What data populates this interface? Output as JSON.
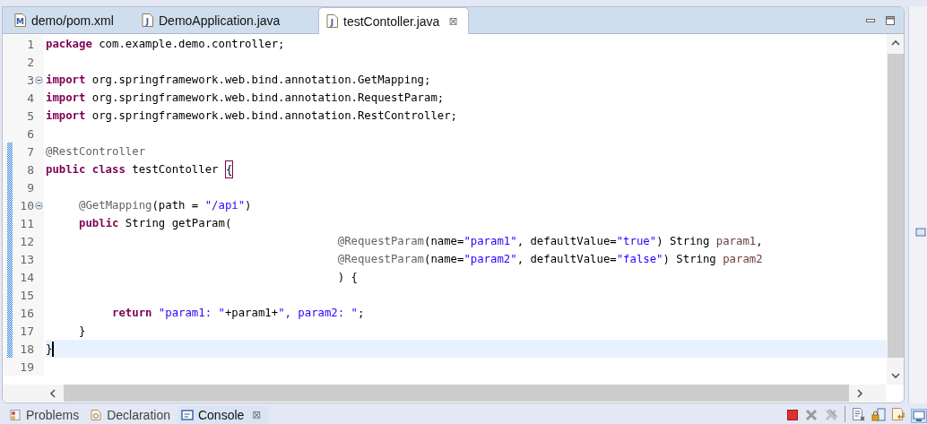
{
  "editor_tabs": [
    {
      "label": "demo/pom.xml",
      "icon": "M",
      "selected": false
    },
    {
      "label": "DemoApplication.java",
      "icon": "J",
      "selected": false
    },
    {
      "label": "testContoller.java",
      "icon": "J",
      "selected": true,
      "close": "⊠"
    }
  ],
  "lines": [
    {
      "number": "1",
      "kind": "top",
      "fold": false,
      "changed": false,
      "current": false,
      "segments": [
        {
          "kind": "keyword",
          "text": "package"
        },
        {
          "kind": "plain",
          "text": "com.example.demo.controller;"
        }
      ]
    },
    {
      "number": "2",
      "kind": "top",
      "fold": false,
      "changed": false,
      "current": false
    },
    {
      "number": "3",
      "kind": "top",
      "fold": true,
      "changed": false,
      "current": false,
      "segments": [
        {
          "kind": "keyword",
          "text": "import"
        },
        {
          "kind": "plain",
          "text": "org.springframework.web.bind.annotation.GetMapping;"
        }
      ]
    },
    {
      "number": "4",
      "kind": "top",
      "fold": false,
      "changed": false,
      "current": false,
      "segments": [
        {
          "kind": "keyword",
          "text": "import"
        },
        {
          "kind": "plain",
          "text": "org.springframework.web.bind.annotation.RequestParam;"
        }
      ]
    },
    {
      "number": "5",
      "kind": "top",
      "fold": false,
      "changed": false,
      "current": false,
      "segments": [
        {
          "kind": "keyword",
          "text": "import"
        },
        {
          "kind": "plain",
          "text": "org.springframework.web.bind.annotation.RestController;"
        }
      ]
    },
    {
      "number": "6",
      "kind": "top",
      "fold": false,
      "changed": false,
      "current": false
    },
    {
      "number": "7",
      "kind": "top",
      "fold": false,
      "changed": true,
      "current": false,
      "segments": [
        {
          "kind": "annotation",
          "text": "@RestController"
        }
      ]
    },
    {
      "number": "8",
      "kind": "top",
      "fold": false,
      "changed": true,
      "current": false,
      "segments": [
        {
          "kind": "keyword",
          "text": "public"
        },
        {
          "kind": "keyword",
          "text": "class"
        },
        {
          "kind": "plain",
          "text": "testContoller"
        },
        {
          "kind": "bracket",
          "text": "{"
        }
      ]
    },
    {
      "number": "9",
      "kind": "top",
      "fold": false,
      "changed": true,
      "current": false
    },
    {
      "number": "10",
      "kind": "member",
      "fold": true,
      "changed": true,
      "current": false,
      "segments": [
        {
          "kind": "annotation",
          "text": "@GetMapping"
        },
        {
          "kind": "plain",
          "text": "(path = "
        },
        {
          "kind": "string",
          "text": "\"/api\""
        },
        {
          "kind": "plain",
          "text": ")"
        }
      ]
    },
    {
      "number": "11",
      "kind": "member",
      "fold": false,
      "changed": true,
      "current": false,
      "segments": [
        {
          "kind": "keyword",
          "text": "public"
        },
        {
          "kind": "plain",
          "text": "String getParam("
        }
      ]
    },
    {
      "number": "12",
      "kind": "argument",
      "fold": false,
      "changed": true,
      "current": false,
      "segments": [
        {
          "kind": "annotation",
          "text": "@RequestParam"
        },
        {
          "kind": "plain",
          "text": "(name="
        },
        {
          "kind": "string",
          "text": "\"param1\""
        },
        {
          "kind": "plain",
          "text": ", defaultValue="
        },
        {
          "kind": "string",
          "text": "\"true\""
        },
        {
          "kind": "plain",
          "text": ") String "
        },
        {
          "kind": "param",
          "text": "param1"
        },
        {
          "kind": "plain",
          "text": ","
        }
      ]
    },
    {
      "number": "13",
      "kind": "argument",
      "fold": false,
      "changed": true,
      "current": false,
      "segments": [
        {
          "kind": "annotation",
          "text": "@RequestParam"
        },
        {
          "kind": "plain",
          "text": "(name="
        },
        {
          "kind": "string",
          "text": "\"param2\""
        },
        {
          "kind": "plain",
          "text": ", defaultValue="
        },
        {
          "kind": "string",
          "text": "\"false\""
        },
        {
          "kind": "plain",
          "text": ") String "
        },
        {
          "kind": "param",
          "text": "param2"
        }
      ]
    },
    {
      "number": "14",
      "kind": "argument",
      "fold": false,
      "changed": true,
      "current": false,
      "segments": [
        {
          "kind": "plain",
          "text": ") {"
        }
      ]
    },
    {
      "number": "15",
      "kind": "top",
      "fold": false,
      "changed": true,
      "current": false
    },
    {
      "number": "16",
      "kind": "statement",
      "fold": false,
      "changed": true,
      "current": false,
      "segments": [
        {
          "kind": "keyword",
          "text": "return"
        },
        {
          "kind": "string",
          "text": "\"param1: \""
        },
        {
          "kind": "plain",
          "text": "+param1+"
        },
        {
          "kind": "string",
          "text": "\", param2: \""
        },
        {
          "kind": "plain",
          "text": ";"
        }
      ]
    },
    {
      "number": "17",
      "kind": "member",
      "fold": false,
      "changed": true,
      "current": false,
      "segments": [
        {
          "kind": "plain",
          "text": "}"
        }
      ]
    },
    {
      "number": "18",
      "kind": "top",
      "fold": false,
      "changed": true,
      "current": true,
      "segments": [
        {
          "kind": "plain",
          "text": "}"
        }
      ]
    },
    {
      "number": "19",
      "kind": "top",
      "fold": false,
      "changed": false,
      "current": false
    }
  ],
  "bottom_tabs": [
    {
      "label": "Problems",
      "selected": false
    },
    {
      "label": "Declaration",
      "selected": false
    },
    {
      "label": "Console",
      "selected": true,
      "close": "⊠"
    }
  ]
}
